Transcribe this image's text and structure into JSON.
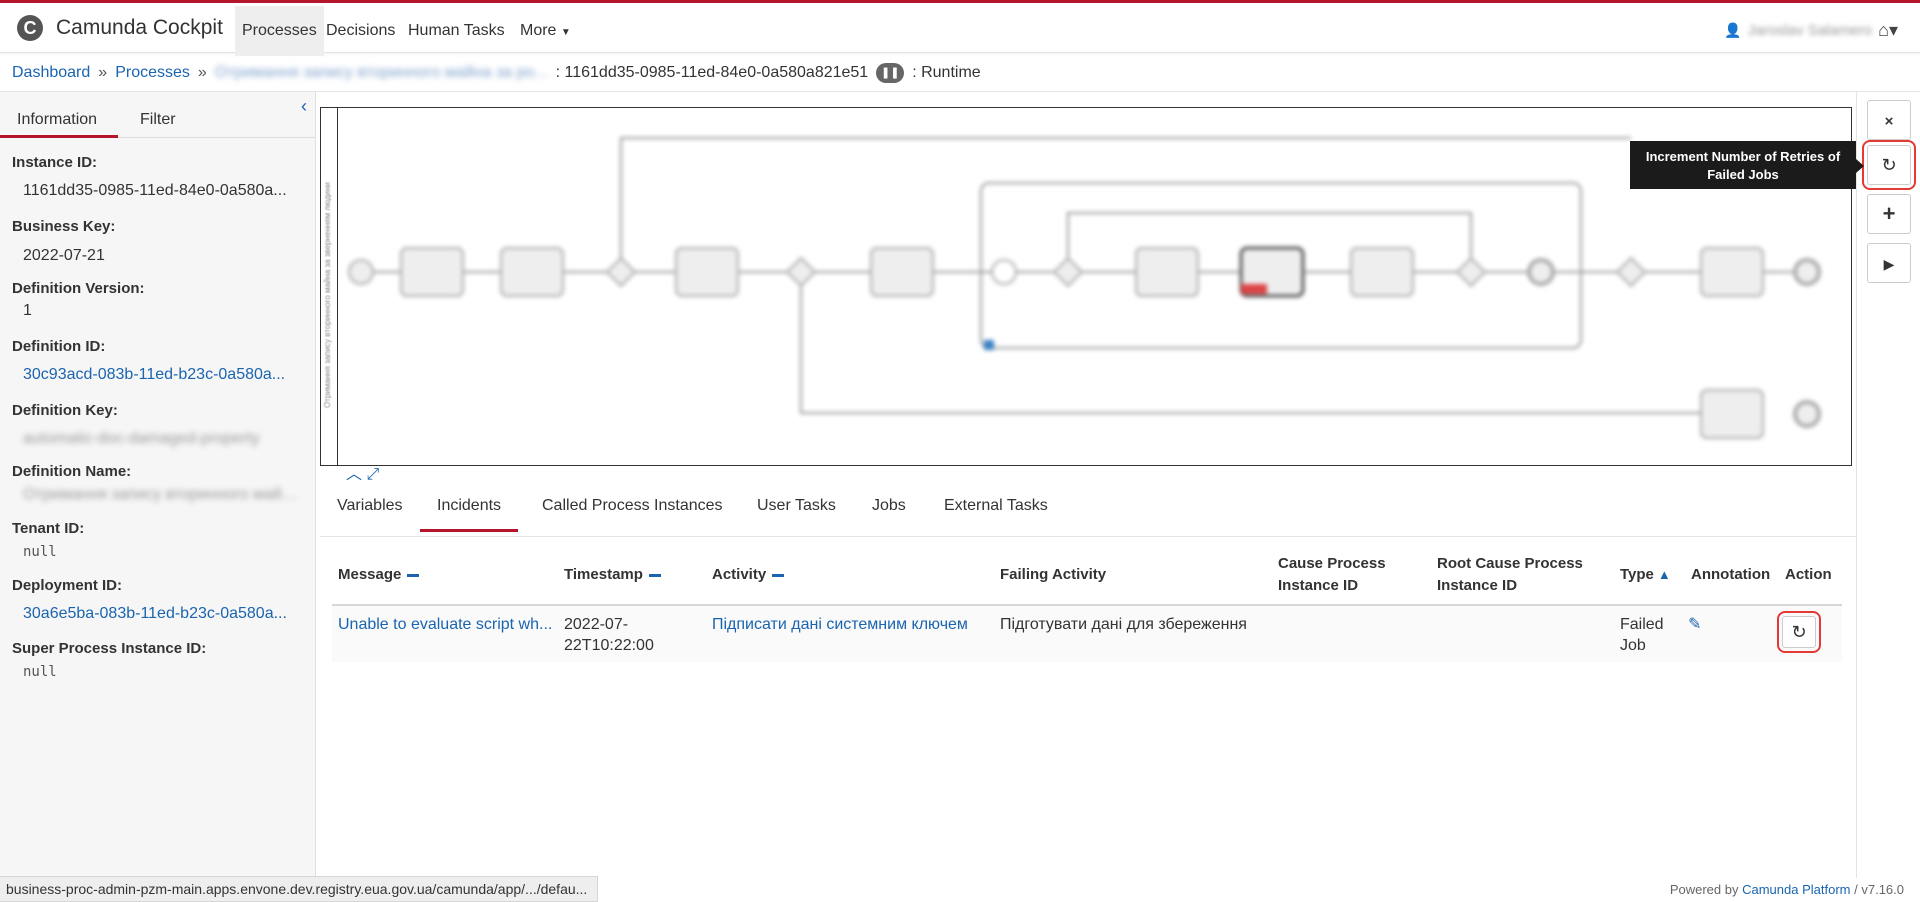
{
  "header": {
    "app_title": "Camunda Cockpit",
    "logo_letter": "C",
    "nav": [
      "Processes",
      "Decisions",
      "Human Tasks",
      "More"
    ],
    "user_name": "Jaroslav Salamero"
  },
  "breadcrumb": {
    "dashboard": "Dashboard",
    "sep": "»",
    "processes": "Processes",
    "process_name": "Отримання запису вторинного майна за ро...",
    "instance_id": ": 1161dd35-0985-11ed-84e0-0a580a821e51",
    "runtime": ": Runtime"
  },
  "sidebar": {
    "tabs": [
      "Information",
      "Filter"
    ],
    "fields": [
      {
        "label": "Instance ID:",
        "value": "1161dd35-0985-11ed-84e0-0a580a..."
      },
      {
        "label": "Business Key:",
        "value": "2022-07-21"
      },
      {
        "label": "Definition Version:",
        "value": "1"
      },
      {
        "label": "Definition ID:",
        "value": "30c93acd-083b-11ed-b23c-0a580a..."
      },
      {
        "label": "Definition Key:",
        "value": "automatic-doc-damaged-property"
      },
      {
        "label": "Definition Name:",
        "value": "Отримання запису вторинного майна..."
      },
      {
        "label": "Tenant ID:",
        "value": "null"
      },
      {
        "label": "Deployment ID:",
        "value": "30a6e5ba-083b-11ed-b23c-0a580a..."
      },
      {
        "label": "Super Process Instance ID:",
        "value": "null"
      }
    ]
  },
  "diagram": {
    "lane_label": "Отримання запису вторинного майна за зверненням людини"
  },
  "right_bar": {
    "tooltip": "Increment Number of Retries of Failed Jobs"
  },
  "tabs": [
    "Variables",
    "Incidents",
    "Called Process Instances",
    "User Tasks",
    "Jobs",
    "External Tasks"
  ],
  "incidents": {
    "columns": [
      "Message",
      "Timestamp",
      "Activity",
      "Failing Activity",
      "Cause Process Instance ID",
      "Root Cause Process Instance ID",
      "Type",
      "Annotation",
      "Action"
    ],
    "rows": [
      {
        "message": "Unable to evaluate script wh...",
        "timestamp_line1": "2022-07-",
        "timestamp_line2": "22T10:22:00",
        "activity": "Підписати дані системним ключем",
        "failing_activity": "Підготувати дані для збереження",
        "cause": "",
        "root_cause": "",
        "type_line1": "Failed",
        "type_line2": "Job"
      }
    ]
  },
  "footer": {
    "status_url": "business-proc-admin-pzm-main.apps.envone.dev.registry.eua.gov.ua/camunda/app/.../defau...",
    "powered_prefix": "Powered by",
    "powered_brand": "Camunda Platform",
    "version": "/ v7.16.0"
  },
  "colors": {
    "accent": "#b5152b",
    "link": "#1a64b0",
    "highlight": "#e53935"
  }
}
